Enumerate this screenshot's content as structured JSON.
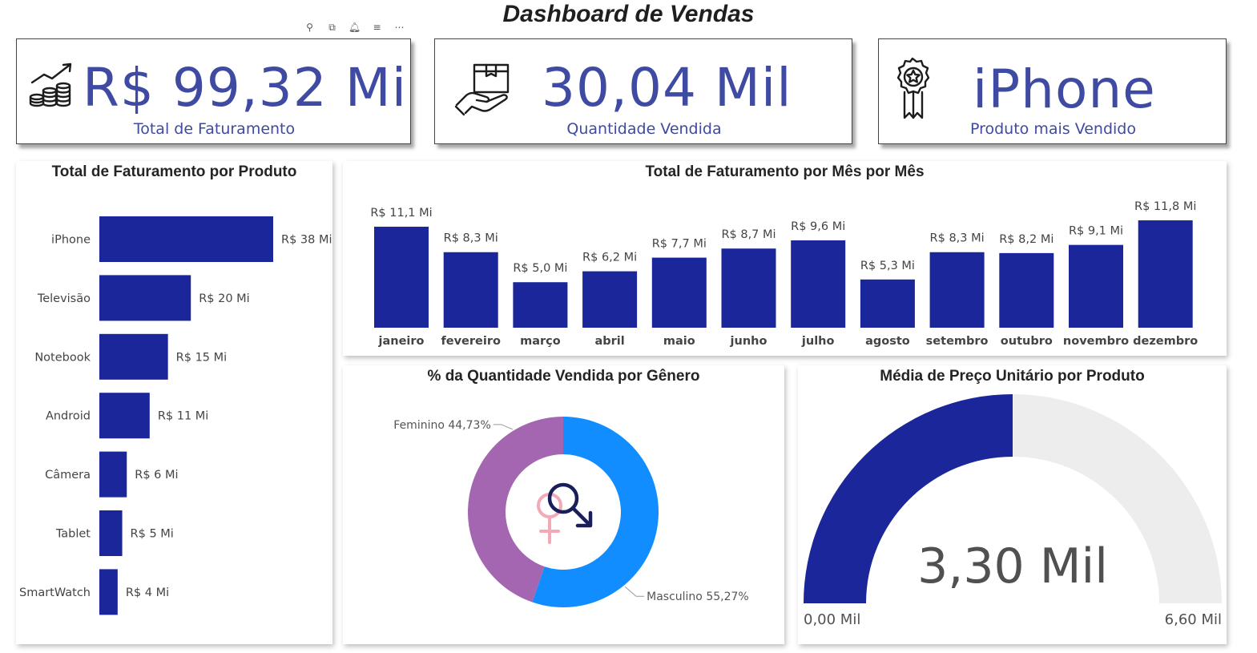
{
  "dashboard": {
    "title": "Dashboard de Vendas"
  },
  "toolbar": {
    "icons": [
      {
        "name": "pin-icon",
        "glyph": "⚲"
      },
      {
        "name": "copy-icon",
        "glyph": "⧉"
      },
      {
        "name": "bell-icon",
        "glyph": "🔔︎"
      },
      {
        "name": "filter-icon",
        "glyph": "≡"
      },
      {
        "name": "more-options-icon",
        "glyph": "⋯"
      }
    ]
  },
  "kpis": [
    {
      "value": "R$ 99,32 Mi",
      "label": "Total de Faturamento",
      "icon": "revenue-growth-icon"
    },
    {
      "value": "30,04 Mil",
      "label": "Quantidade Vendida",
      "icon": "box-in-hand-icon"
    },
    {
      "value": "iPhone",
      "label": "Produto mais Vendido",
      "icon": "award-ribbon-icon"
    }
  ],
  "colors": {
    "bar": "#1a2699",
    "kpi_text": "#3f4aa3",
    "female": "#a466b0",
    "male": "#118dff",
    "gauge_fill": "#1a2699",
    "gauge_track": "#eeeded"
  },
  "chart_data": [
    {
      "type": "bar",
      "orientation": "horizontal",
      "title": "Total de Faturamento por Produto",
      "categories": [
        "iPhone",
        "Televisão",
        "Notebook",
        "Android",
        "Câmera",
        "Tablet",
        "SmartWatch"
      ],
      "values": [
        38,
        20,
        15,
        11,
        6,
        5,
        4
      ],
      "data_labels": [
        "R$ 38 Mi",
        "R$ 20 Mi",
        "R$ 15 Mi",
        "R$ 11 Mi",
        "R$ 6 Mi",
        "R$ 5 Mi",
        "R$ 4 Mi"
      ],
      "unit": "R$ Mi"
    },
    {
      "type": "bar",
      "orientation": "vertical",
      "title": "Total de Faturamento por Mês por Mês",
      "categories": [
        "janeiro",
        "fevereiro",
        "março",
        "abril",
        "maio",
        "junho",
        "julho",
        "agosto",
        "setembro",
        "outubro",
        "novembro",
        "dezembro"
      ],
      "values": [
        11.1,
        8.3,
        5.0,
        6.2,
        7.7,
        8.7,
        9.6,
        5.3,
        8.3,
        8.2,
        9.1,
        11.8
      ],
      "data_labels": [
        "R$ 11,1 Mi",
        "R$ 8,3 Mi",
        "R$ 5,0 Mi",
        "R$ 6,2 Mi",
        "R$ 7,7 Mi",
        "R$ 8,7 Mi",
        "R$ 9,6 Mi",
        "R$ 5,3 Mi",
        "R$ 8,3 Mi",
        "R$ 8,2 Mi",
        "R$ 9,1 Mi",
        "R$ 11,8 Mi"
      ],
      "unit": "R$ Mi"
    },
    {
      "type": "pie",
      "variant": "donut",
      "title": "% da Quantidade Vendida por Gênero",
      "categories": [
        "Feminino",
        "Masculino"
      ],
      "values": [
        44.73,
        55.27
      ],
      "data_labels": [
        "Feminino 44,73%",
        "Masculino 55,27%"
      ],
      "center_icon": "gender-symbols-icon"
    },
    {
      "type": "gauge",
      "title": "Média de Preço Unitário por Produto",
      "value": 3.3,
      "min": 0,
      "max": 6.6,
      "value_label": "3,30 Mil",
      "min_label": "0,00 Mil",
      "max_label": "6,60 Mil"
    }
  ]
}
